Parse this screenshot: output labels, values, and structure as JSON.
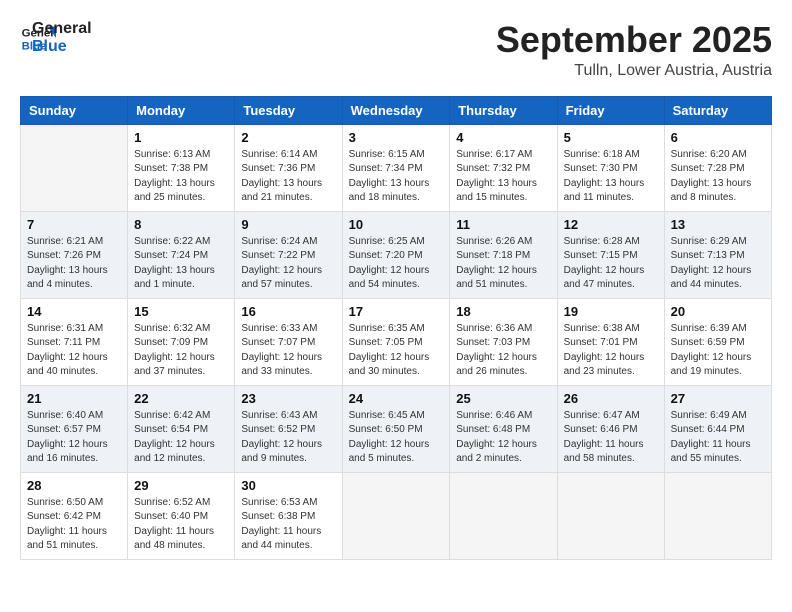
{
  "header": {
    "logo_line1": "General",
    "logo_line2": "Blue",
    "month": "September 2025",
    "location": "Tulln, Lower Austria, Austria"
  },
  "days_of_week": [
    "Sunday",
    "Monday",
    "Tuesday",
    "Wednesday",
    "Thursday",
    "Friday",
    "Saturday"
  ],
  "weeks": [
    [
      {
        "day": "",
        "empty": true
      },
      {
        "day": "1",
        "sunrise": "Sunrise: 6:13 AM",
        "sunset": "Sunset: 7:38 PM",
        "daylight": "Daylight: 13 hours and 25 minutes."
      },
      {
        "day": "2",
        "sunrise": "Sunrise: 6:14 AM",
        "sunset": "Sunset: 7:36 PM",
        "daylight": "Daylight: 13 hours and 21 minutes."
      },
      {
        "day": "3",
        "sunrise": "Sunrise: 6:15 AM",
        "sunset": "Sunset: 7:34 PM",
        "daylight": "Daylight: 13 hours and 18 minutes."
      },
      {
        "day": "4",
        "sunrise": "Sunrise: 6:17 AM",
        "sunset": "Sunset: 7:32 PM",
        "daylight": "Daylight: 13 hours and 15 minutes."
      },
      {
        "day": "5",
        "sunrise": "Sunrise: 6:18 AM",
        "sunset": "Sunset: 7:30 PM",
        "daylight": "Daylight: 13 hours and 11 minutes."
      },
      {
        "day": "6",
        "sunrise": "Sunrise: 6:20 AM",
        "sunset": "Sunset: 7:28 PM",
        "daylight": "Daylight: 13 hours and 8 minutes."
      }
    ],
    [
      {
        "day": "7",
        "sunrise": "Sunrise: 6:21 AM",
        "sunset": "Sunset: 7:26 PM",
        "daylight": "Daylight: 13 hours and 4 minutes."
      },
      {
        "day": "8",
        "sunrise": "Sunrise: 6:22 AM",
        "sunset": "Sunset: 7:24 PM",
        "daylight": "Daylight: 13 hours and 1 minute."
      },
      {
        "day": "9",
        "sunrise": "Sunrise: 6:24 AM",
        "sunset": "Sunset: 7:22 PM",
        "daylight": "Daylight: 12 hours and 57 minutes."
      },
      {
        "day": "10",
        "sunrise": "Sunrise: 6:25 AM",
        "sunset": "Sunset: 7:20 PM",
        "daylight": "Daylight: 12 hours and 54 minutes."
      },
      {
        "day": "11",
        "sunrise": "Sunrise: 6:26 AM",
        "sunset": "Sunset: 7:18 PM",
        "daylight": "Daylight: 12 hours and 51 minutes."
      },
      {
        "day": "12",
        "sunrise": "Sunrise: 6:28 AM",
        "sunset": "Sunset: 7:15 PM",
        "daylight": "Daylight: 12 hours and 47 minutes."
      },
      {
        "day": "13",
        "sunrise": "Sunrise: 6:29 AM",
        "sunset": "Sunset: 7:13 PM",
        "daylight": "Daylight: 12 hours and 44 minutes."
      }
    ],
    [
      {
        "day": "14",
        "sunrise": "Sunrise: 6:31 AM",
        "sunset": "Sunset: 7:11 PM",
        "daylight": "Daylight: 12 hours and 40 minutes."
      },
      {
        "day": "15",
        "sunrise": "Sunrise: 6:32 AM",
        "sunset": "Sunset: 7:09 PM",
        "daylight": "Daylight: 12 hours and 37 minutes."
      },
      {
        "day": "16",
        "sunrise": "Sunrise: 6:33 AM",
        "sunset": "Sunset: 7:07 PM",
        "daylight": "Daylight: 12 hours and 33 minutes."
      },
      {
        "day": "17",
        "sunrise": "Sunrise: 6:35 AM",
        "sunset": "Sunset: 7:05 PM",
        "daylight": "Daylight: 12 hours and 30 minutes."
      },
      {
        "day": "18",
        "sunrise": "Sunrise: 6:36 AM",
        "sunset": "Sunset: 7:03 PM",
        "daylight": "Daylight: 12 hours and 26 minutes."
      },
      {
        "day": "19",
        "sunrise": "Sunrise: 6:38 AM",
        "sunset": "Sunset: 7:01 PM",
        "daylight": "Daylight: 12 hours and 23 minutes."
      },
      {
        "day": "20",
        "sunrise": "Sunrise: 6:39 AM",
        "sunset": "Sunset: 6:59 PM",
        "daylight": "Daylight: 12 hours and 19 minutes."
      }
    ],
    [
      {
        "day": "21",
        "sunrise": "Sunrise: 6:40 AM",
        "sunset": "Sunset: 6:57 PM",
        "daylight": "Daylight: 12 hours and 16 minutes."
      },
      {
        "day": "22",
        "sunrise": "Sunrise: 6:42 AM",
        "sunset": "Sunset: 6:54 PM",
        "daylight": "Daylight: 12 hours and 12 minutes."
      },
      {
        "day": "23",
        "sunrise": "Sunrise: 6:43 AM",
        "sunset": "Sunset: 6:52 PM",
        "daylight": "Daylight: 12 hours and 9 minutes."
      },
      {
        "day": "24",
        "sunrise": "Sunrise: 6:45 AM",
        "sunset": "Sunset: 6:50 PM",
        "daylight": "Daylight: 12 hours and 5 minutes."
      },
      {
        "day": "25",
        "sunrise": "Sunrise: 6:46 AM",
        "sunset": "Sunset: 6:48 PM",
        "daylight": "Daylight: 12 hours and 2 minutes."
      },
      {
        "day": "26",
        "sunrise": "Sunrise: 6:47 AM",
        "sunset": "Sunset: 6:46 PM",
        "daylight": "Daylight: 11 hours and 58 minutes."
      },
      {
        "day": "27",
        "sunrise": "Sunrise: 6:49 AM",
        "sunset": "Sunset: 6:44 PM",
        "daylight": "Daylight: 11 hours and 55 minutes."
      }
    ],
    [
      {
        "day": "28",
        "sunrise": "Sunrise: 6:50 AM",
        "sunset": "Sunset: 6:42 PM",
        "daylight": "Daylight: 11 hours and 51 minutes."
      },
      {
        "day": "29",
        "sunrise": "Sunrise: 6:52 AM",
        "sunset": "Sunset: 6:40 PM",
        "daylight": "Daylight: 11 hours and 48 minutes."
      },
      {
        "day": "30",
        "sunrise": "Sunrise: 6:53 AM",
        "sunset": "Sunset: 6:38 PM",
        "daylight": "Daylight: 11 hours and 44 minutes."
      },
      {
        "day": "",
        "empty": true
      },
      {
        "day": "",
        "empty": true
      },
      {
        "day": "",
        "empty": true
      },
      {
        "day": "",
        "empty": true
      }
    ]
  ]
}
